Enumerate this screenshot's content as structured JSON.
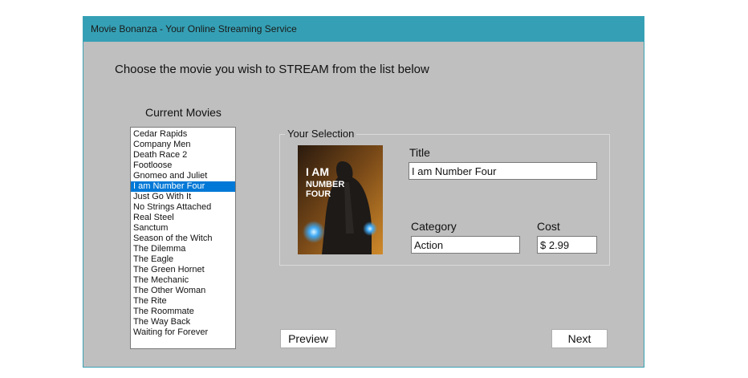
{
  "window": {
    "title": "Movie Bonanza - Your Online Streaming Service"
  },
  "instruction": "Choose the movie you wish to STREAM from the list below",
  "movie_list": {
    "label": "Current Movies",
    "items": [
      "Cedar Rapids",
      "Company Men",
      "Death Race 2",
      "Footloose",
      "Gnomeo and Juliet",
      "I am Number Four",
      "Just Go With It",
      "No Strings Attached",
      "Real Steel",
      "Sanctum",
      "Season of the Witch",
      "The Dilemma",
      "The Eagle",
      "The Green Hornet",
      "The Mechanic",
      "The Other Woman",
      "The Rite",
      "The Roommate",
      "The Way Back",
      "Waiting for Forever"
    ],
    "selected_index": 5
  },
  "selection": {
    "legend": "Your Selection",
    "title_label": "Title",
    "title_value": "I am Number Four",
    "category_label": "Category",
    "category_value": "Action",
    "cost_label": "Cost",
    "cost_value": "$ 2.99",
    "poster": {
      "text_line1": "I AM",
      "text_line2": "NUMBER",
      "text_line3": "FOUR"
    }
  },
  "buttons": {
    "preview": "Preview",
    "next": "Next"
  },
  "colors": {
    "titlebar": "#35a0b5",
    "window_bg": "#bfbfbf",
    "selection_highlight": "#0078d7"
  }
}
